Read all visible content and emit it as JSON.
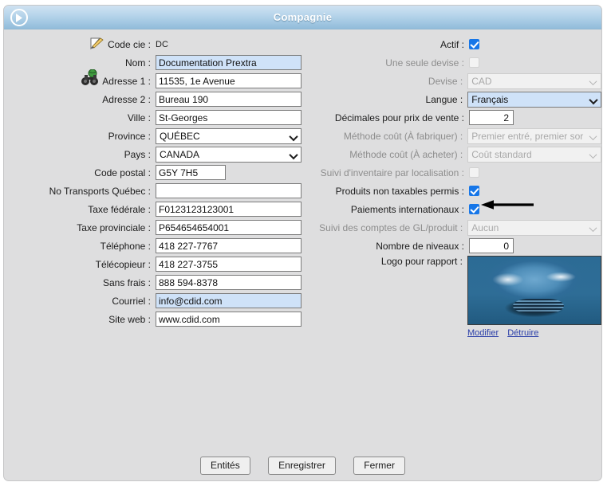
{
  "window": {
    "title": "Compagnie",
    "nav_icon": "play-circle-icon"
  },
  "left_column": [
    {
      "label": "Code cie :",
      "type": "text-static",
      "value": "DC",
      "icon": "pencil-icon"
    },
    {
      "label": "Nom :",
      "type": "input",
      "value": "Documentation Prextra",
      "highlighted": true
    },
    {
      "label": "Adresse 1 :",
      "type": "input",
      "value": "11535, 1e Avenue",
      "icon": "binoculars-icon"
    },
    {
      "label": "Adresse 2 :",
      "type": "input",
      "value": "Bureau 190"
    },
    {
      "label": "Ville :",
      "type": "input",
      "value": "St-Georges"
    },
    {
      "label": "Province :",
      "type": "select",
      "value": "QUÉBEC"
    },
    {
      "label": "Pays :",
      "type": "select",
      "value": "CANADA"
    },
    {
      "label": "Code postal :",
      "type": "input-short",
      "value": "G5Y 7H5"
    },
    {
      "label": "No Transports Québec :",
      "type": "input",
      "value": ""
    },
    {
      "label": "Taxe fédérale :",
      "type": "input",
      "value": "F0123123123001"
    },
    {
      "label": "Taxe provinciale :",
      "type": "input",
      "value": "P654654654001"
    },
    {
      "label": "Téléphone :",
      "type": "input",
      "value": "418 227-7767"
    },
    {
      "label": "Télécopieur :",
      "type": "input",
      "value": "418 227-3755"
    },
    {
      "label": "Sans frais :",
      "type": "input",
      "value": "888 594-8378"
    },
    {
      "label": "Courriel :",
      "type": "input",
      "value": "info@cdid.com",
      "highlighted": true
    },
    {
      "label": "Site web :",
      "type": "input",
      "value": "www.cdid.com"
    }
  ],
  "right_column": [
    {
      "label": "Actif :",
      "type": "checkbox",
      "checked": true
    },
    {
      "label": "Une seule devise :",
      "type": "checkbox",
      "checked": false,
      "disabled": true
    },
    {
      "label": "Devise :",
      "type": "select",
      "value": "CAD",
      "disabled": true
    },
    {
      "label": "Langue :",
      "type": "select",
      "value": "Français",
      "highlighted": true
    },
    {
      "label": "Décimales pour prix de vente :",
      "type": "number",
      "value": "2"
    },
    {
      "label": "Méthode coût (À fabriquer) :",
      "type": "select",
      "value": "Premier entré, premier sor",
      "disabled": true
    },
    {
      "label": "Méthode coût (À acheter) :",
      "type": "select",
      "value": "Coût standard",
      "disabled": true
    },
    {
      "label": "Suivi d'inventaire par localisation :",
      "type": "checkbox",
      "checked": false,
      "disabled": true
    },
    {
      "label": "Produits non taxables permis :",
      "type": "checkbox",
      "checked": true,
      "annotated": true
    },
    {
      "label": "Paiements internationaux :",
      "type": "checkbox",
      "checked": true
    },
    {
      "label": "Suivi des comptes de GL/produit :",
      "type": "select",
      "value": "Aucun",
      "disabled": true
    },
    {
      "label": "Nombre de niveaux :",
      "type": "number",
      "value": "0"
    },
    {
      "label": "Logo pour rapport :",
      "type": "image"
    }
  ],
  "logo": {
    "alt": "company-logo",
    "edit_link": "Modifier",
    "delete_link": "Détruire"
  },
  "footer": {
    "buttons": [
      {
        "label": "Entités",
        "name": "entites-button"
      },
      {
        "label": "Enregistrer",
        "name": "enregistrer-button"
      },
      {
        "label": "Fermer",
        "name": "fermer-button"
      }
    ]
  },
  "annotation": {
    "type": "left-arrow",
    "color": "#000000",
    "points_to": "Produits non taxables permis"
  },
  "colors": {
    "titlebar_top": "#cfe2f1",
    "titlebar_bottom": "#92bcda",
    "panel_bg": "#dededf",
    "highlight_field": "#cfe2f8",
    "checkbox_on": "#1676e8",
    "link": "#2a3ea8"
  }
}
